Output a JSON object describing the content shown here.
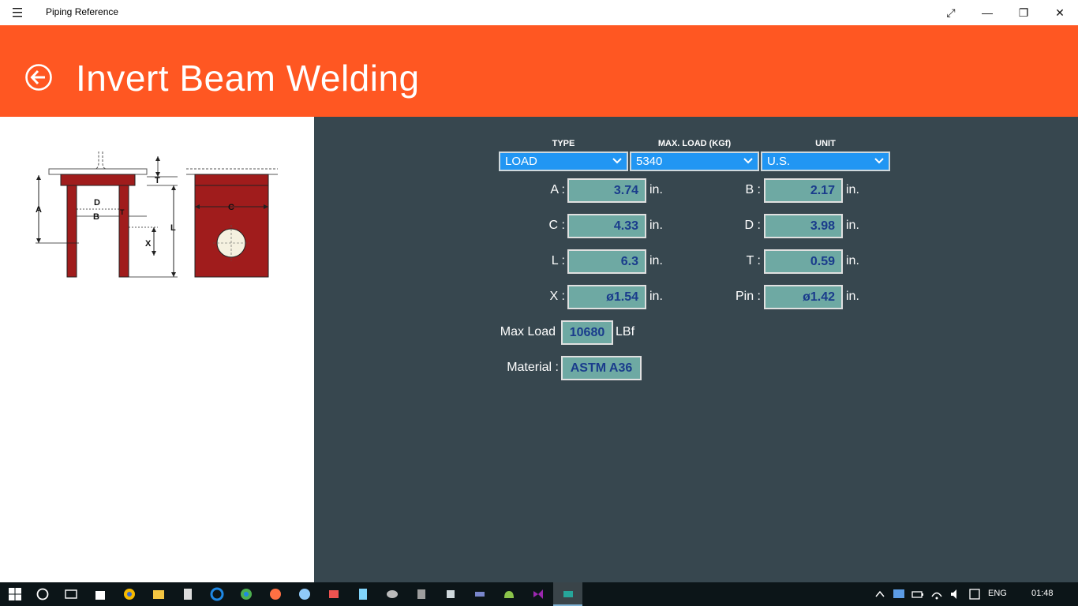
{
  "window": {
    "app_title": "Piping Reference",
    "controls": {
      "fullscreen": "⤢",
      "minimize": "—",
      "restore": "❐",
      "close": "✕"
    }
  },
  "header": {
    "title": "Invert Beam Welding",
    "accent_color": "#ff5722"
  },
  "diagram": {
    "labels": {
      "A": "A",
      "B": "B",
      "C": "C",
      "D": "D",
      "T": "T",
      "L": "L",
      "X": "X"
    },
    "beam_color": "#a01c1c"
  },
  "selectors": {
    "type": {
      "label": "TYPE",
      "value": "LOAD"
    },
    "max_load": {
      "label": "MAX. LOAD (KGf)",
      "value": "5340"
    },
    "unit": {
      "label": "UNIT",
      "value": "U.S."
    }
  },
  "fields": {
    "A": {
      "label": "A :",
      "value": "3.74",
      "unit": "in."
    },
    "B": {
      "label": "B :",
      "value": "2.17",
      "unit": "in."
    },
    "C": {
      "label": "C :",
      "value": "4.33",
      "unit": "in."
    },
    "D": {
      "label": "D :",
      "value": "3.98",
      "unit": "in."
    },
    "L": {
      "label": "L :",
      "value": "6.3",
      "unit": "in."
    },
    "T": {
      "label": "T :",
      "value": "0.59",
      "unit": "in."
    },
    "X": {
      "label": "X :",
      "value": "ø1.54",
      "unit": "in."
    },
    "Pin": {
      "label": "Pin :",
      "value": "ø1.42",
      "unit": "in."
    },
    "max_load": {
      "label": "Max Load",
      "value": "10680",
      "unit": "LBf"
    },
    "material": {
      "label": "Material :",
      "value": "ASTM A36"
    }
  },
  "taskbar": {
    "language": "ENG",
    "time": "01:48"
  }
}
